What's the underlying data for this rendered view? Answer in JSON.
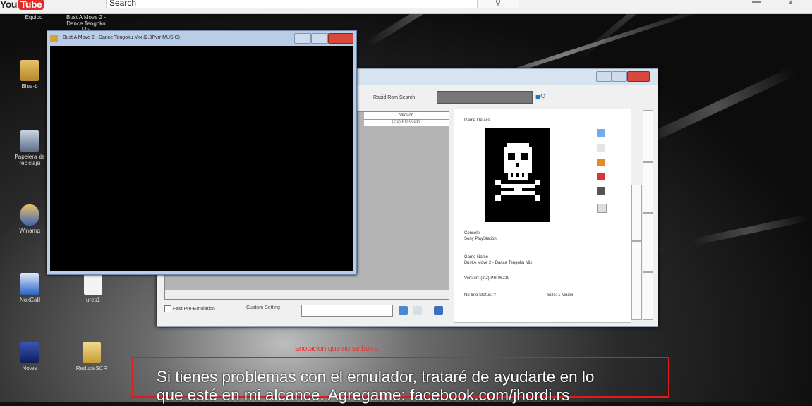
{
  "header": {
    "logo_text": "You",
    "logo_tube": "Tube",
    "search_value": "Search",
    "search_icon": "search-icon"
  },
  "desktop": {
    "icons": [
      {
        "label": "Equipo",
        "icon": "computer-icon"
      },
      {
        "label": "Blue-b",
        "icon": "folder-icon"
      },
      {
        "label": "Papelera de reciclaje",
        "icon": "recycle-bin-icon"
      },
      {
        "label": "Winamp",
        "icon": "winamp-icon"
      },
      {
        "label": "NoxCall",
        "icon": "app-icon"
      },
      {
        "label": "ures1",
        "icon": "file-icon"
      },
      {
        "label": "Notes",
        "icon": "app-icon"
      },
      {
        "label": "ReduceSCR",
        "icon": "folder-icon"
      }
    ],
    "top_label": "Bust A Move 2 - Dance Tengoku Mix"
  },
  "emulator_window": {
    "title": "Bust A Move 2 - Dance Tengoku Mix (2.3Pvrr MUSIC)"
  },
  "app_window": {
    "toolbar": {
      "rapid_search_label": "Rapid Rom Search"
    },
    "list": {
      "column_header": "Version",
      "row_value": "(2.2) PH-06219"
    },
    "bottom": {
      "fast_pre_emulation": "Fast Pre-Emulation",
      "custom_setting": "Custom Setting"
    },
    "details": {
      "heading": "Game Details",
      "console_label": "Console",
      "console_value": "Sony PlayStation",
      "game_name_label": "Game Name",
      "game_name_value": "Bust A Move 2 - Dance Tengoku Mix",
      "version_value": "Version: (2.2) PH-06219",
      "status_label": "No Info Status: ?",
      "size_label": "Size: 1 Model"
    }
  },
  "subtitle": {
    "annotation": "anotacion que no se borra",
    "line1": "Si tienes problemas con el emulador, trataré de ayudarte en lo",
    "line2": "que esté en mi alcance. Agregame: facebook.com/jhordi.rs"
  },
  "colors": {
    "caption_border": "#e01b1b",
    "annotation": "#e33333",
    "yt_red": "#e52d27"
  }
}
